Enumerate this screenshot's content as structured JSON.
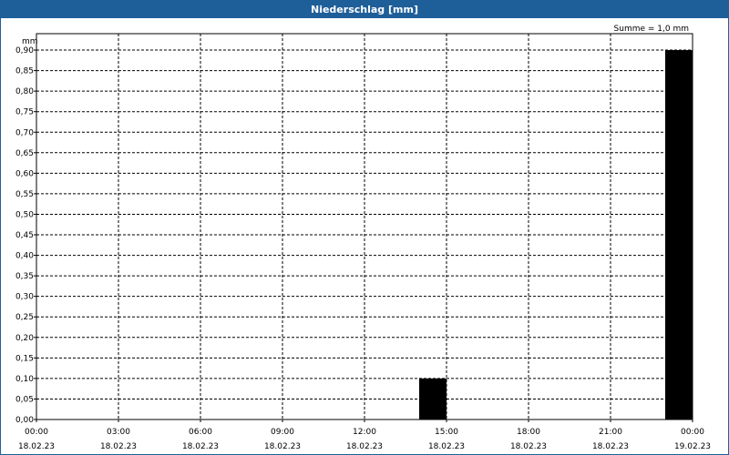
{
  "window": {
    "title": "Niederschlag [mm]"
  },
  "chart_data": {
    "type": "bar",
    "title": "Niederschlag [mm]",
    "ylabel": "mm",
    "annotation": "Summe = 1,0 mm",
    "ylim": [
      0,
      0.94
    ],
    "yticks": [
      0,
      0.05,
      0.1,
      0.15,
      0.2,
      0.25,
      0.3,
      0.35,
      0.4,
      0.45,
      0.5,
      0.55,
      0.6,
      0.65,
      0.7,
      0.75,
      0.8,
      0.85,
      0.9
    ],
    "ytick_labels": [
      "0,00",
      "0,05",
      "0,10",
      "0,15",
      "0,20",
      "0,25",
      "0,30",
      "0,35",
      "0,40",
      "0,45",
      "0,50",
      "0,55",
      "0,60",
      "0,65",
      "0,70",
      "0,75",
      "0,80",
      "0,85",
      "0,90"
    ],
    "xticks": [
      {
        "time": "00:00",
        "date": "18.02.23"
      },
      {
        "time": "03:00",
        "date": "18.02.23"
      },
      {
        "time": "06:00",
        "date": "18.02.23"
      },
      {
        "time": "09:00",
        "date": "18.02.23"
      },
      {
        "time": "12:00",
        "date": "18.02.23"
      },
      {
        "time": "15:00",
        "date": "18.02.23"
      },
      {
        "time": "18:00",
        "date": "18.02.23"
      },
      {
        "time": "21:00",
        "date": "18.02.23"
      },
      {
        "time": "00:00",
        "date": "19.02.23"
      }
    ],
    "bars": [
      {
        "start": "14:00",
        "end": "15:00",
        "date": "18.02.23",
        "value": 0.1
      },
      {
        "start": "23:00",
        "end": "00:00",
        "date": "18.02.23",
        "value": 0.9
      }
    ],
    "grid": true,
    "bar_color": "#000000"
  }
}
